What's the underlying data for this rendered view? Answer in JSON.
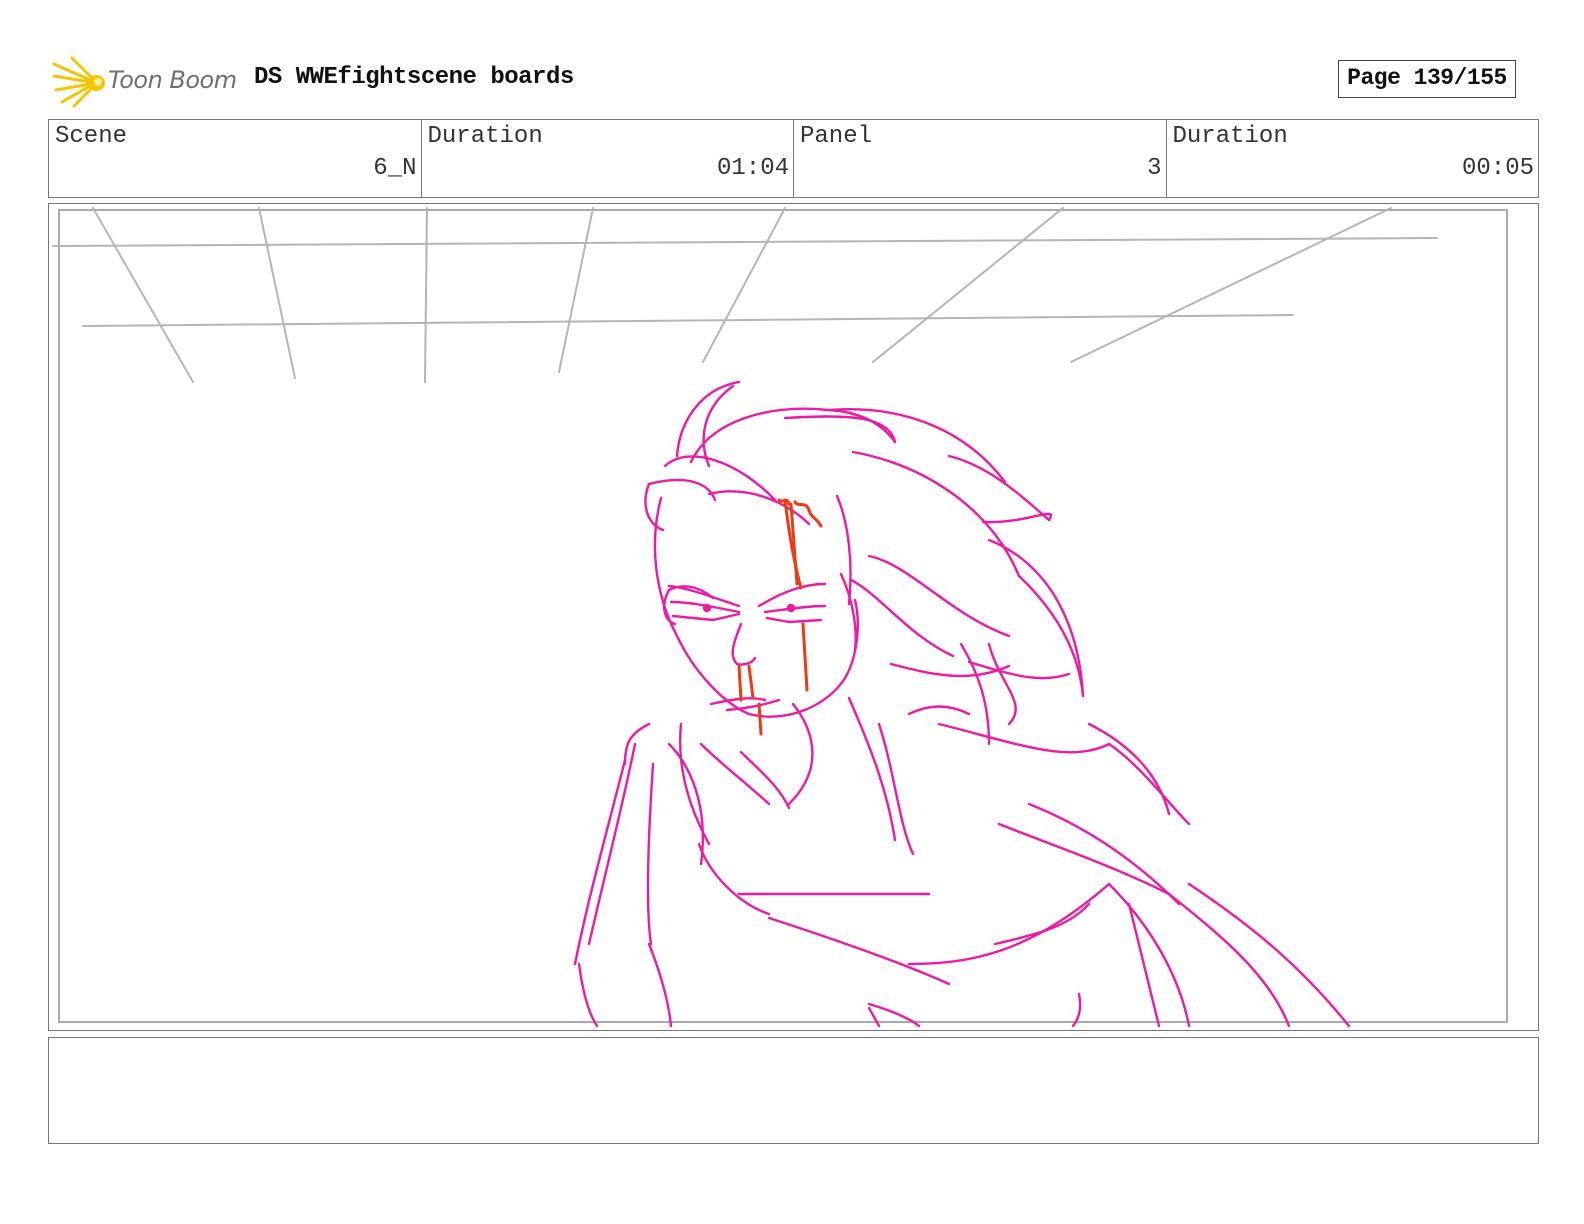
{
  "header": {
    "logo_text": "Toon Boom",
    "title": "DS WWEfightscene boards",
    "page_label": "Page 139/155"
  },
  "info": [
    {
      "label": "Scene",
      "value": "6_N"
    },
    {
      "label": "Duration",
      "value": "01:04"
    },
    {
      "label": "Panel",
      "value": "3"
    },
    {
      "label": "Duration",
      "value": "00:05"
    }
  ],
  "panel": {
    "sketch_colors": {
      "character": "#ee1aa3",
      "blood": "#ee3a12",
      "background_lines": "#b5b5b5"
    }
  },
  "notes": {
    "text": ""
  }
}
